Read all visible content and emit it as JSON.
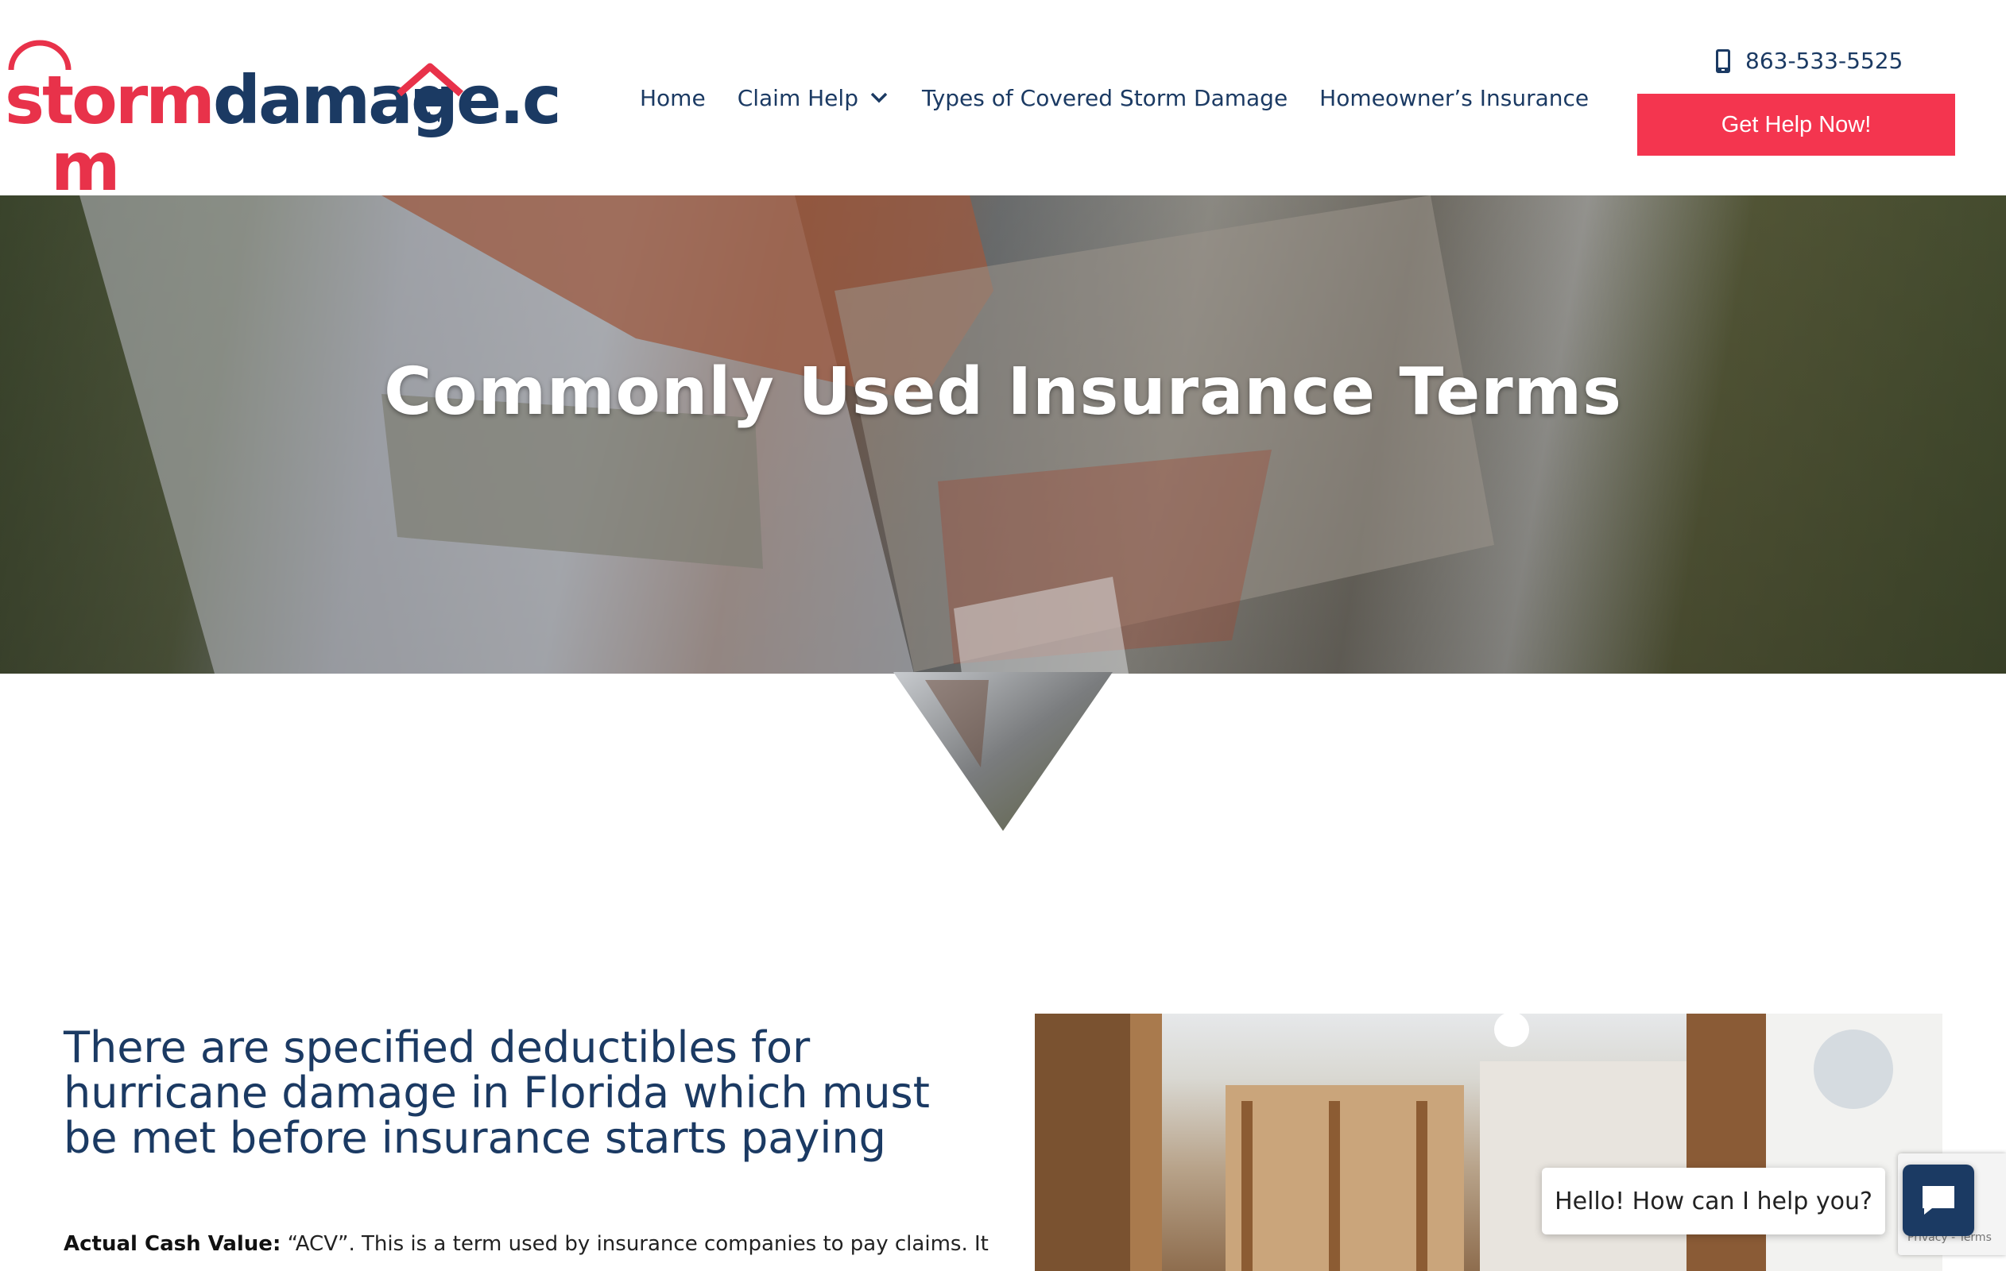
{
  "header": {
    "logo": {
      "part1": "storm",
      "part2": "damage",
      "part3": ".c",
      "part4": "m"
    },
    "nav": [
      {
        "label": "Home"
      },
      {
        "label": "Claim Help",
        "has_dropdown": true
      },
      {
        "label": "Types of Covered Storm Damage"
      },
      {
        "label": "Homeowner’s Insurance"
      }
    ],
    "phone": "863-533-5525",
    "cta_label": "Get Help Now!"
  },
  "hero": {
    "title": "Commonly Used Insurance Terms"
  },
  "content": {
    "heading": "There are specified deductibles for hurricane damage in Florida which must be met before insurance starts paying",
    "term_label": "Actual Cash Value:",
    "term_text": " “ACV”. This is a term used by insurance companies to pay claims. It"
  },
  "chat": {
    "greeting": "Hello! How can I help you?"
  },
  "recaptcha": {
    "text": "Privacy - Terms"
  },
  "colors": {
    "brand_red": "#f4354f",
    "brand_navy": "#1b3a63"
  }
}
